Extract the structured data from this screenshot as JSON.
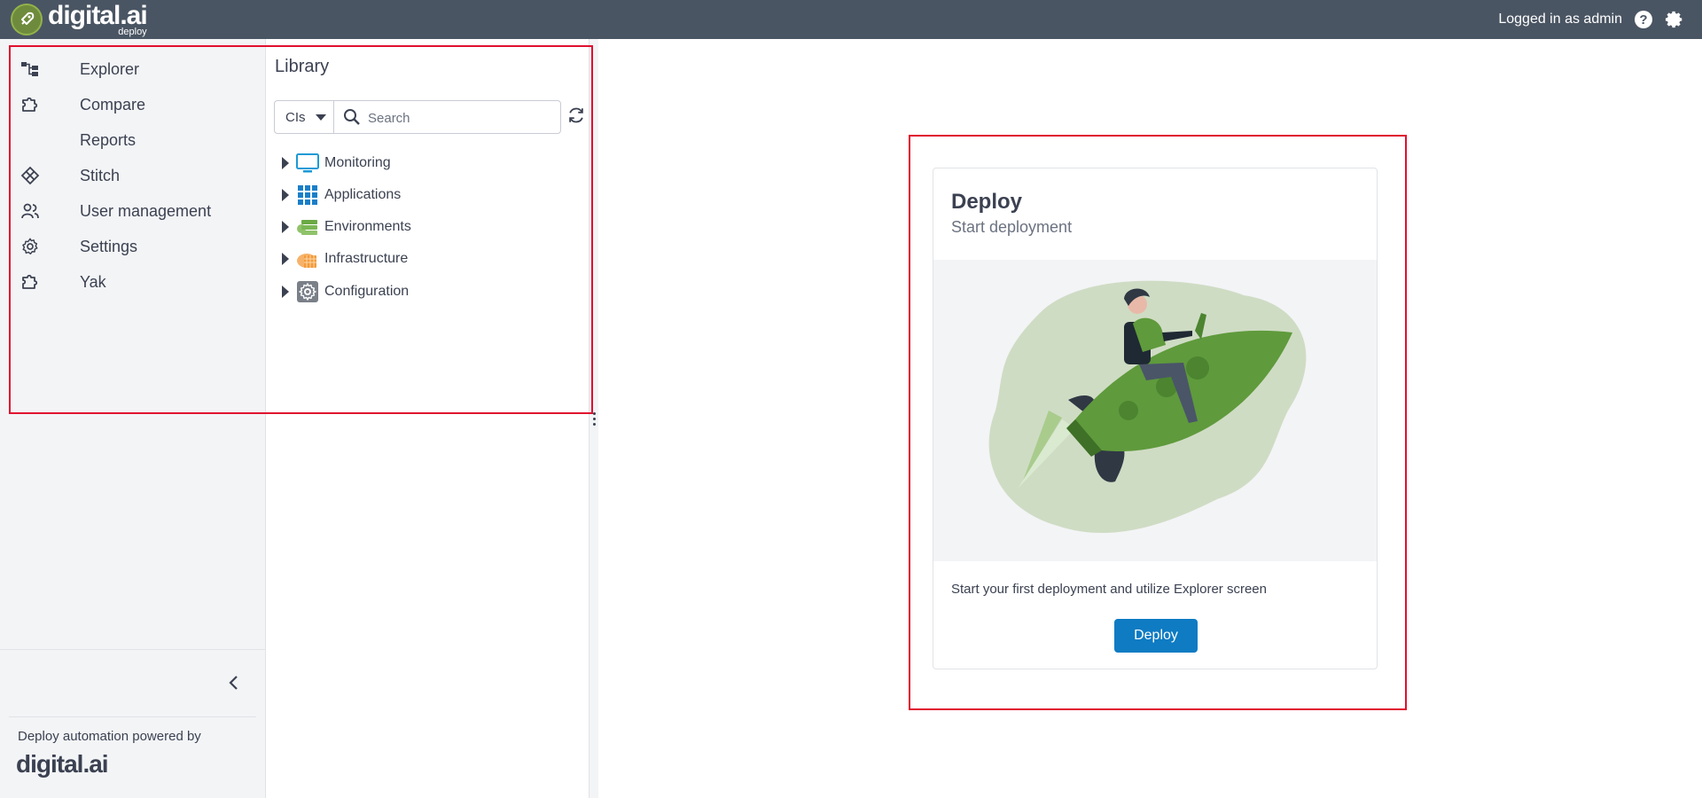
{
  "header": {
    "brand": "digital.ai",
    "product": "deploy",
    "logged_in": "Logged in as admin",
    "help_icon": "question-circle-icon",
    "settings_icon": "gear-icon"
  },
  "nav": {
    "items": [
      {
        "label": "Explorer",
        "icon": "tree-icon"
      },
      {
        "label": "Compare",
        "icon": "puzzle-icon"
      },
      {
        "label": "Reports",
        "icon": ""
      },
      {
        "label": "Stitch",
        "icon": "stitch-icon"
      },
      {
        "label": "User management",
        "icon": "users-icon"
      },
      {
        "label": "Settings",
        "icon": "gear-icon"
      },
      {
        "label": "Yak",
        "icon": "puzzle-icon"
      }
    ],
    "footer_text": "Deploy automation powered by",
    "footer_brand": "digital.ai"
  },
  "library": {
    "title": "Library",
    "filter_value": "CIs",
    "search_placeholder": "Search",
    "tree": [
      {
        "label": "Monitoring",
        "icon": "monitor-icon"
      },
      {
        "label": "Applications",
        "icon": "grid-icon"
      },
      {
        "label": "Environments",
        "icon": "servers-icon"
      },
      {
        "label": "Infrastructure",
        "icon": "cloud-icon"
      },
      {
        "label": "Configuration",
        "icon": "config-gear-icon"
      }
    ]
  },
  "card": {
    "title": "Deploy",
    "subtitle": "Start deployment",
    "description": "Start your first deployment and utilize Explorer screen",
    "button": "Deploy"
  },
  "colors": {
    "topbar": "#4a5563",
    "nav_bg": "#f3f4f6",
    "primary": "#0e7bc3",
    "highlight": "#e0102f",
    "rocket_green": "#5f9a3c"
  }
}
